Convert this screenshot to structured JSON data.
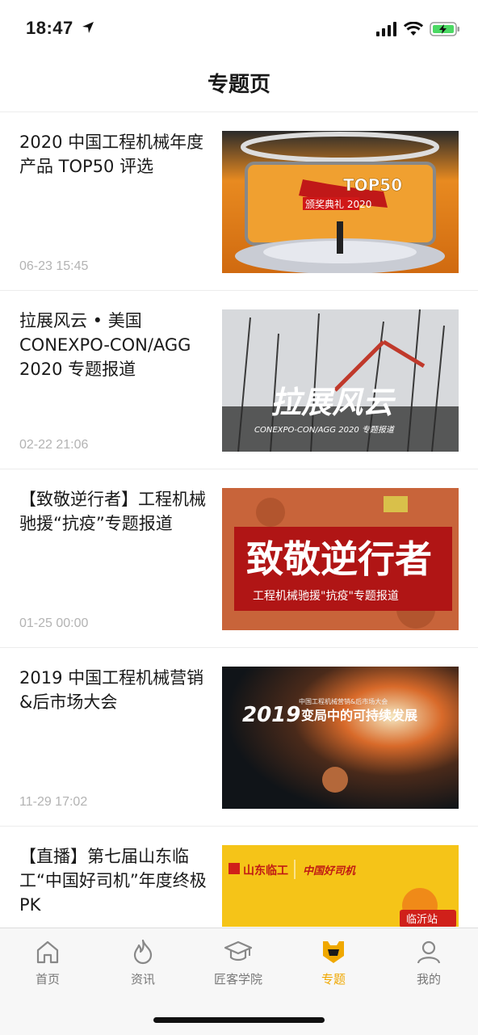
{
  "status": {
    "time": "18:47"
  },
  "header": {
    "title": "专题页"
  },
  "items": [
    {
      "title": "2020 中国工程机械年度产品 TOP50 评选",
      "time": "06-23 15:45",
      "thumb_text": "颁奖典礼 2020",
      "thumb_logo": "TOP50"
    },
    {
      "title": "拉展风云 • 美国 CONEXPO-CON/AGG 2020 专题报道",
      "time": "02-22 21:06",
      "thumb_text": "拉展风云",
      "thumb_sub": "CONEXPO-CON/AGG 2020 专题报道"
    },
    {
      "title": "【致敬逆行者】工程机械驰援“抗疫”专题报道",
      "time": "01-25 00:00",
      "thumb_text": "致敬逆行者",
      "thumb_sub": "工程机械驰援\"抗疫\"专题报道"
    },
    {
      "title": "2019 中国工程机械营销&后市场大会",
      "time": "11-29 17:02",
      "thumb_text": "2019",
      "thumb_sub": "变局中的可持续发展",
      "thumb_top": "中国工程机械营销&后市场大会"
    },
    {
      "title": "【直播】第七届山东临工“中国好司机”年度终极 PK",
      "time": "",
      "thumb_text": "山东临工",
      "thumb_sub": "中国好司机",
      "thumb_tag": "临沂站"
    }
  ],
  "tabs": [
    {
      "label": "首页",
      "icon": "home-icon"
    },
    {
      "label": "资讯",
      "icon": "flame-icon"
    },
    {
      "label": "匠客学院",
      "icon": "graduation-cap-icon"
    },
    {
      "label": "专题",
      "icon": "topic-icon",
      "active": true
    },
    {
      "label": "我的",
      "icon": "person-icon"
    }
  ],
  "colors": {
    "accent": "#f0a800",
    "text": "#1a1a1a",
    "muted": "#b3b3b3"
  }
}
